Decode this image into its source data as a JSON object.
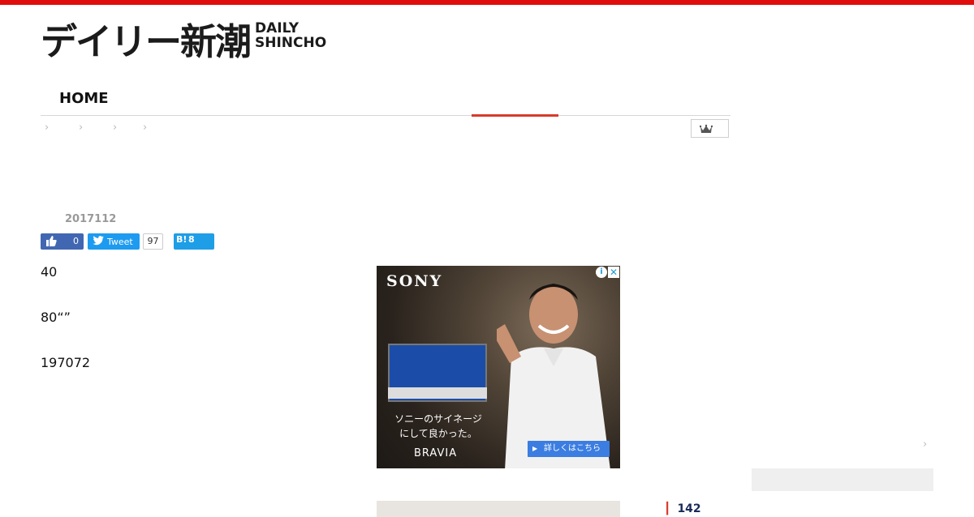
{
  "logo": {
    "jp": "デイリー新潮",
    "en_line1": "DAILY",
    "en_line2": "SHINCHO"
  },
  "nav": {
    "home": "HOME"
  },
  "breadcrumbs": [
    "›",
    "›",
    "›",
    "›"
  ],
  "article": {
    "title": "",
    "date": "2017112",
    "paragraphs": [
      "40",
      "80“”",
      "",
      "197072"
    ]
  },
  "social": {
    "fb_count": "0",
    "tweet_label": "Tweet",
    "tweet_count": "97",
    "hatena_label": "B!",
    "hatena_count": "8"
  },
  "ad": {
    "brand": "SONY",
    "tagline_1": "ソニーのサイネージ",
    "tagline_2": "にして良かった。",
    "product": "BRAVIA",
    "cta": "詳しくはこちら",
    "info": "i",
    "close": "✕",
    "arrow": "▶"
  },
  "sidebar": {
    "title": "",
    "chevron": "›",
    "rank_num": "142"
  },
  "colors": {
    "accent": "#e00d0d",
    "nav_active": "#d93a2b",
    "facebook": "#4267b2",
    "twitter": "#1d9bf0",
    "hatena": "#1e9ee6"
  }
}
